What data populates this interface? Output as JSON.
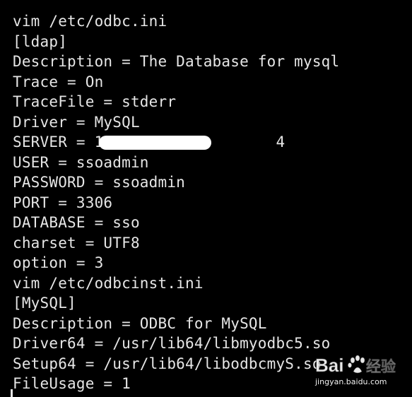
{
  "terminal": {
    "background": "#000000",
    "text_color": "#e6e6e6",
    "lines": [
      "vim /etc/odbc.ini",
      "[ldap]",
      "Description = The Database for mysql",
      "Trace = On",
      "TraceFile = stderr",
      "Driver = MySQL",
      "SERVER = 1                   4",
      "USER = ssoadmin",
      "PASSWORD = ssoadmin",
      "PORT = 3306",
      "DATABASE = sso",
      "charset = UTF8",
      "option = 3",
      "vim /etc/odbcinst.ini",
      "[MySQL]",
      "Description = ODBC for MySQL",
      "Driver64 = /usr/lib64/libmyodbc5.so",
      "Setup64 = /usr/lib64/libodbcmyS.so",
      "FileUsage = 1"
    ]
  },
  "watermark": {
    "logo_text": "Bai经验",
    "url": "jingyan.baidu.com"
  }
}
